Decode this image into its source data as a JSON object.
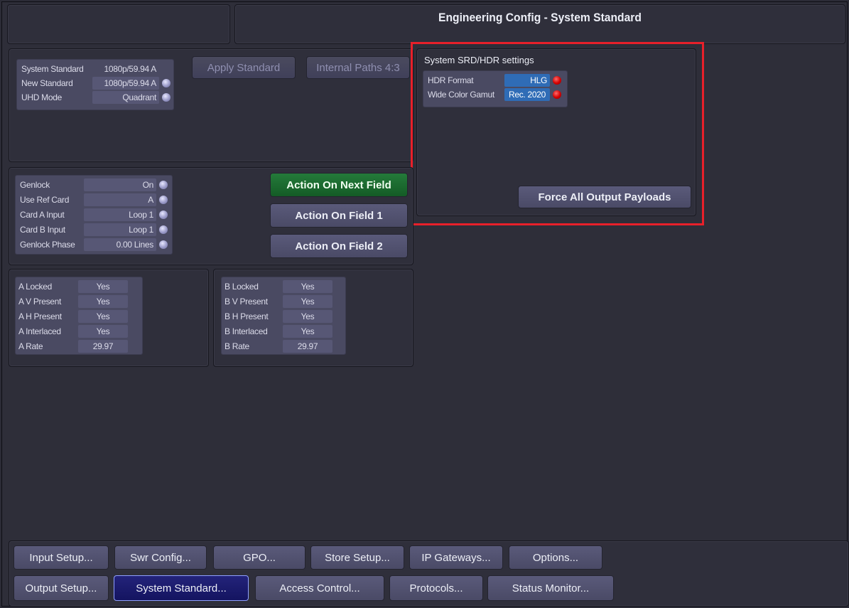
{
  "header": {
    "title": "Engineering Config - System Standard"
  },
  "standard_panel": {
    "rows": [
      {
        "label": "System Standard",
        "value": "1080p/59.94 A"
      },
      {
        "label": "New Standard",
        "value": "1080p/59.94 A"
      },
      {
        "label": "UHD Mode",
        "value": "Quadrant"
      }
    ],
    "apply_label": "Apply Standard",
    "internal_paths_label": "Internal Paths 4:3"
  },
  "hdr_panel": {
    "title": "System SRD/HDR settings",
    "rows": [
      {
        "label": "HDR Format",
        "value": "HLG"
      },
      {
        "label": "Wide Color Gamut",
        "value": "Rec. 2020"
      }
    ],
    "force_label": "Force All Output Payloads"
  },
  "genlock_panel": {
    "rows": [
      {
        "label": "Genlock",
        "value": "On"
      },
      {
        "label": "Use Ref Card",
        "value": "A"
      },
      {
        "label": "Card A Input",
        "value": "Loop 1"
      },
      {
        "label": "Card B Input",
        "value": "Loop 1"
      },
      {
        "label": "Genlock Phase",
        "value": "0.00 Lines"
      }
    ],
    "action_next": "Action On Next Field",
    "action_field1": "Action On Field 1",
    "action_field2": "Action On Field 2"
  },
  "card_a": {
    "rows": [
      {
        "label": "A Locked",
        "value": "Yes"
      },
      {
        "label": "A V Present",
        "value": "Yes"
      },
      {
        "label": "A H Present",
        "value": "Yes"
      },
      {
        "label": "A Interlaced",
        "value": "Yes"
      },
      {
        "label": "A Rate",
        "value": "29.97"
      }
    ]
  },
  "card_b": {
    "rows": [
      {
        "label": "B Locked",
        "value": "Yes"
      },
      {
        "label": "B V Present",
        "value": "Yes"
      },
      {
        "label": "B H Present",
        "value": "Yes"
      },
      {
        "label": "B Interlaced",
        "value": "Yes"
      },
      {
        "label": "B Rate",
        "value": "29.97"
      }
    ]
  },
  "nav": {
    "row1": [
      "Input Setup...",
      "Swr Config...",
      "GPO...",
      "Store Setup...",
      "IP Gateways...",
      "Options..."
    ],
    "row2": [
      "Output Setup...",
      "System Standard...",
      "Access Control...",
      "Protocols...",
      "Status Monitor..."
    ]
  },
  "colors": {
    "background": "#2b2b36",
    "field": "#575775",
    "highlight": "#e8202a",
    "green_button": "#1d6b30",
    "selected_button": "#1b1b6e",
    "red_indicator": "#d40000",
    "blue_value": "#2f6cb6"
  }
}
